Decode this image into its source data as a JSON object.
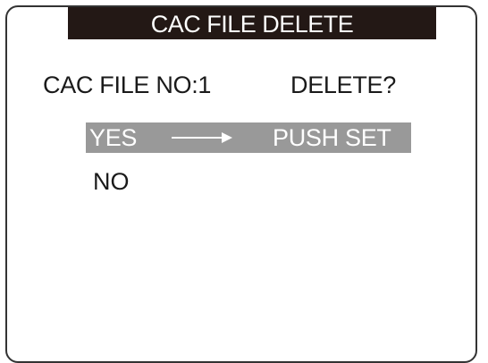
{
  "screen": {
    "title": "CAC FILE DELETE"
  },
  "prompt": {
    "file_label": "CAC FILE NO:1",
    "question": "DELETE?"
  },
  "options": {
    "yes": {
      "label": "YES",
      "arrow_icon": "arrow-right-icon",
      "action": "PUSH SET",
      "selected": true
    },
    "no": {
      "label": "NO",
      "selected": false
    }
  },
  "colors": {
    "title_bar_bg": "#231815",
    "selection_bg": "#999999",
    "text": "#1a1a1a"
  }
}
